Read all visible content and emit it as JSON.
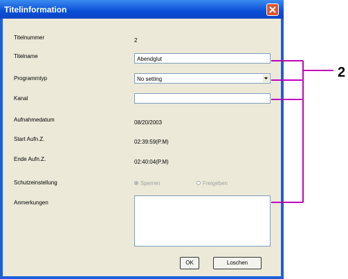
{
  "window": {
    "title": "Titelinformation"
  },
  "fields": {
    "titelnummer_label": "Titelnummer",
    "titelnummer_value": "2",
    "titelname_label": "Titelname",
    "titelname_value": "Abendglut",
    "programmtyp_label": "Programmtyp",
    "programmtyp_value": "No setting",
    "kanal_label": "Kanal",
    "kanal_value": "",
    "aufnahmedatum_label": "Aufnahmedatum",
    "aufnahmedatum_value": "08/20/2003",
    "start_label": "Start Aufn.Z.",
    "start_value": "02:39:59(P.M)",
    "ende_label": "Ende Aufn.Z.",
    "ende_value": "02:40:04(P.M)",
    "schutz_label": "Schutzeinstellung",
    "option_sperren": "Sperren",
    "option_freigeben": "Freigeben",
    "anmerkungen_label": "Anmerkungen",
    "anmerkungen_value": ""
  },
  "buttons": {
    "ok": "OK",
    "loschen": "Loschen"
  },
  "callout": {
    "label": "2"
  }
}
